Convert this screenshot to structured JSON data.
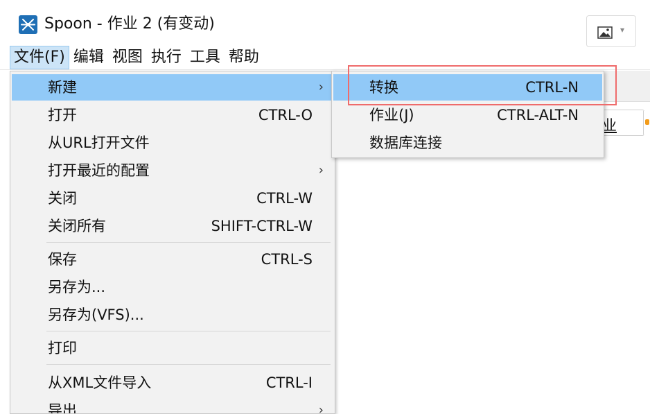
{
  "window": {
    "title": "Spoon - 作业 2 (有变动)",
    "app_icon": "spoon-logo-icon",
    "picture_button_icon": "image-icon",
    "picture_button_caret": "▾"
  },
  "menubar": {
    "items": [
      {
        "label": "文件(F)",
        "active": true
      },
      {
        "label": "编辑"
      },
      {
        "label": "视图"
      },
      {
        "label": "执行"
      },
      {
        "label": "工具"
      },
      {
        "label": "帮助"
      }
    ]
  },
  "background": {
    "tab_label": "业"
  },
  "file_menu": {
    "items": [
      {
        "label": "新建",
        "shortcut": "",
        "arrow": "›"
      },
      {
        "label": "打开",
        "shortcut": "CTRL-O"
      },
      {
        "label": "从URL打开文件",
        "shortcut": ""
      },
      {
        "label": "打开最近的配置",
        "shortcut": "",
        "arrow": "›"
      },
      {
        "label": "关闭",
        "shortcut": "CTRL-W"
      },
      {
        "label": "关闭所有",
        "shortcut": "SHIFT-CTRL-W"
      },
      {
        "label": "保存",
        "shortcut": "CTRL-S"
      },
      {
        "label": "另存为...",
        "shortcut": ""
      },
      {
        "label": "另存为(VFS)...",
        "shortcut": ""
      },
      {
        "label": "打印",
        "shortcut": ""
      },
      {
        "label": "从XML文件导入",
        "shortcut": "CTRL-I"
      },
      {
        "label": "导出",
        "shortcut": "",
        "arrow": "›"
      }
    ]
  },
  "new_submenu": {
    "items": [
      {
        "label": "转换",
        "shortcut": "CTRL-N"
      },
      {
        "label": "作业(J)",
        "shortcut": "CTRL-ALT-N"
      },
      {
        "label": "数据库连接",
        "shortcut": ""
      }
    ]
  },
  "colors": {
    "highlight": "#91c9f7",
    "menu_bg": "#f2f2f2",
    "annotation_box": "#ef6b6b",
    "app_icon_bg": "#1f6fb5"
  }
}
